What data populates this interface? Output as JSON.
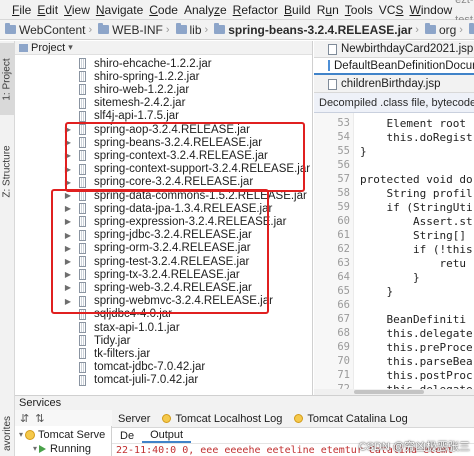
{
  "window": {
    "title": "ezt-test"
  },
  "menu": [
    {
      "pre": "",
      "u": "F",
      "post": "ile"
    },
    {
      "pre": "",
      "u": "E",
      "post": "dit"
    },
    {
      "pre": "",
      "u": "V",
      "post": "iew"
    },
    {
      "pre": "",
      "u": "N",
      "post": "avigate"
    },
    {
      "pre": "",
      "u": "C",
      "post": "ode"
    },
    {
      "pre": "Analy",
      "u": "z",
      "post": "e"
    },
    {
      "pre": "",
      "u": "R",
      "post": "efactor"
    },
    {
      "pre": "",
      "u": "B",
      "post": "uild"
    },
    {
      "pre": "R",
      "u": "u",
      "post": "n"
    },
    {
      "pre": "",
      "u": "T",
      "post": "ools"
    },
    {
      "pre": "VC",
      "u": "S",
      "post": ""
    },
    {
      "pre": "",
      "u": "W",
      "post": "indow"
    }
  ],
  "breadcrumb": [
    "WebContent",
    "WEB-INF",
    "lib",
    "spring-beans-3.2.4.RELEASE.jar",
    "org",
    "springframework",
    "beans",
    "factory",
    "s"
  ],
  "left_strip": {
    "project_tab": "1: Project",
    "structure_tab": "Z: Structure",
    "favorites_tab": "avorites"
  },
  "project_panel": {
    "title": "Project"
  },
  "tree": [
    {
      "label": "shiro-ehcache-1.2.2.jar",
      "expandable": false
    },
    {
      "label": "shiro-spring-1.2.2.jar",
      "expandable": false
    },
    {
      "label": "shiro-web-1.2.2.jar",
      "expandable": false
    },
    {
      "label": "sitemesh-2.4.2.jar",
      "expandable": false
    },
    {
      "label": "slf4j-api-1.7.5.jar",
      "expandable": false
    },
    {
      "label": "spring-aop-3.2.4.RELEASE.jar",
      "expandable": true
    },
    {
      "label": "spring-beans-3.2.4.RELEASE.jar",
      "expandable": true
    },
    {
      "label": "spring-context-3.2.4.RELEASE.jar",
      "expandable": true
    },
    {
      "label": "spring-context-support-3.2.4.RELEASE.jar",
      "expandable": true
    },
    {
      "label": "spring-core-3.2.4.RELEASE.jar",
      "expandable": true
    },
    {
      "label": "spring-data-commons-1.5.2.RELEASE.jar",
      "expandable": true
    },
    {
      "label": "spring-data-jpa-1.3.4.RELEASE.jar",
      "expandable": true
    },
    {
      "label": "spring-expression-3.2.4.RELEASE.jar",
      "expandable": true
    },
    {
      "label": "spring-jdbc-3.2.4.RELEASE.jar",
      "expandable": true
    },
    {
      "label": "spring-orm-3.2.4.RELEASE.jar",
      "expandable": true
    },
    {
      "label": "spring-test-3.2.4.RELEASE.jar",
      "expandable": true
    },
    {
      "label": "spring-tx-3.2.4.RELEASE.jar",
      "expandable": true
    },
    {
      "label": "spring-web-3.2.4.RELEASE.jar",
      "expandable": true
    },
    {
      "label": "spring-webmvc-3.2.4.RELEASE.jar",
      "expandable": true
    },
    {
      "label": "sqljdbc4-4.0.jar",
      "expandable": false
    },
    {
      "label": "stax-api-1.0.1.jar",
      "expandable": false
    },
    {
      "label": "Tidy.jar",
      "expandable": false
    },
    {
      "label": "tk-filters.jar",
      "expandable": false
    },
    {
      "label": "tomcat-jdbc-7.0.42.jar",
      "expandable": false
    },
    {
      "label": "tomcat-juli-7.0.42.jar",
      "expandable": false
    }
  ],
  "editor": {
    "tabs": [
      "NewbirthdayCard2021.jsp",
      "DefaultBeanDefinitionDocur",
      "childrenBirthday.jsp"
    ],
    "banner": "Decompiled .class file, bytecode versi",
    "lines": [
      {
        "n": "53",
        "html": "        Element root"
      },
      {
        "n": "54",
        "html": "        <span class=\"kw\">this</span>.<span class=\"fld\">doRegist</span>"
      },
      {
        "n": "55",
        "html": "    }"
      },
      {
        "n": "56",
        "html": ""
      },
      {
        "n": "57",
        "html": "    <span class=\"kw\">protected void</span> do"
      },
      {
        "n": "58",
        "html": "        String profil"
      },
      {
        "n": "59",
        "html": "        <span class=\"kw\">if</span> (StringUti"
      },
      {
        "n": "60",
        "html": "            Assert.st"
      },
      {
        "n": "61",
        "html": "            String[]"
      },
      {
        "n": "62",
        "html": "            <span class=\"kw\">if</span> (!this"
      },
      {
        "n": "63",
        "html": "                <span class=\"kw\">retu</span>"
      },
      {
        "n": "64",
        "html": "            }"
      },
      {
        "n": "65",
        "html": "        }"
      },
      {
        "n": "66",
        "html": ""
      },
      {
        "n": "67",
        "html": "        BeanDefiniti"
      },
      {
        "n": "68",
        "html": "        <span class=\"kw\">this</span>.<span class=\"fld\">delegate</span>"
      },
      {
        "n": "69",
        "html": "        <span class=\"kw\">this</span>.preProce"
      },
      {
        "n": "70",
        "html": "        <span class=\"kw\">this</span>.parseBea"
      },
      {
        "n": "71",
        "html": "        <span class=\"kw\">this</span>.postProc"
      },
      {
        "n": "72",
        "html": "        <span class=\"kw\">this</span>.<span class=\"fld\">delegate</span>"
      }
    ]
  },
  "services": {
    "title": "Services",
    "tree": [
      "Tomcat Serve",
      "Running"
    ],
    "tabs": [
      "Server",
      "Tomcat Localhost Log",
      "Tomcat Catalina Log"
    ],
    "subtabs": [
      "De",
      "Output"
    ],
    "output_line": "22-11:40:0 0, eee eeeehe eeteline etemtur Catalina etemt",
    "watermark": "CSDN @穷凶极恶张三"
  }
}
